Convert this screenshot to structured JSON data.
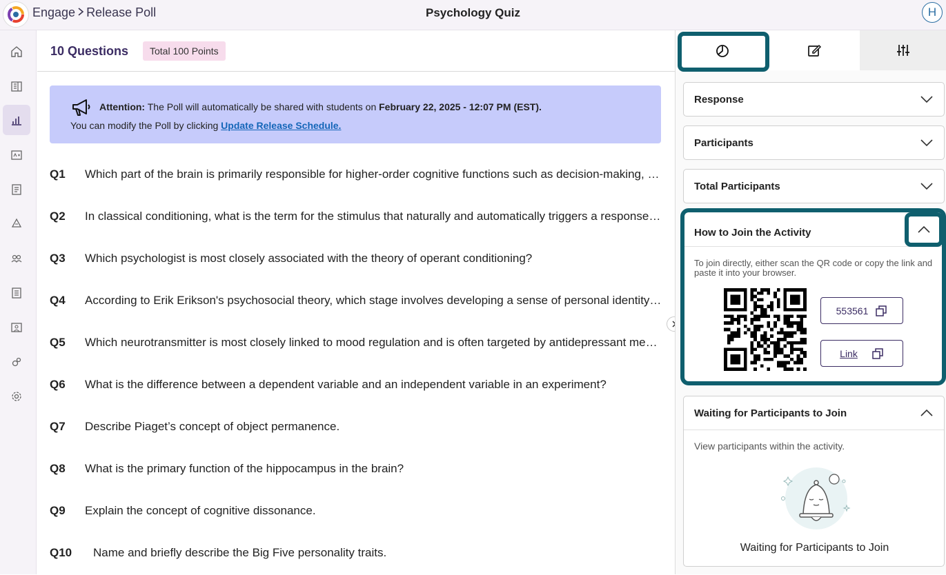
{
  "header": {
    "breadcrumb": [
      "Engage",
      "Release Poll"
    ],
    "title": "Psychology Quiz",
    "avatar_initial": "H"
  },
  "sidebar": {
    "items": [
      {
        "icon": "home-icon",
        "active": false
      },
      {
        "icon": "library-icon",
        "active": false
      },
      {
        "icon": "bar-chart-icon",
        "active": true
      },
      {
        "icon": "grades-icon",
        "active": false
      },
      {
        "icon": "document-icon",
        "active": false
      },
      {
        "icon": "recycle-icon",
        "active": false
      },
      {
        "icon": "users-icon",
        "active": false
      },
      {
        "icon": "list-icon",
        "active": false
      },
      {
        "icon": "gallery-icon",
        "active": false
      },
      {
        "icon": "puzzle-icon",
        "active": false
      },
      {
        "icon": "settings-icon",
        "active": false
      }
    ]
  },
  "main": {
    "question_count": "10 Questions",
    "total_points": "Total 100 Points",
    "attention": {
      "label": "Attention:",
      "message": " The Poll will automatically be shared with students on ",
      "datetime": "February 22, 2025 - 12:07 PM (EST).",
      "line2_prefix": "You can modify the Poll by clicking ",
      "link": "Update Release Schedule."
    },
    "questions": [
      {
        "num": "Q1",
        "text": "Which part of the brain is primarily responsible for higher-order cognitive functions such as decision-making, planning, and problem-solving?"
      },
      {
        "num": "Q2",
        "text": "In classical conditioning, what is the term for the stimulus that naturally and automatically triggers a response without prior learning?"
      },
      {
        "num": "Q3",
        "text": "Which psychologist is most closely associated with the theory of operant conditioning?"
      },
      {
        "num": "Q4",
        "text": "According to Erik Erikson's psychosocial theory, which stage involves developing a sense of personal identity during adolescence?"
      },
      {
        "num": "Q5",
        "text": "Which neurotransmitter is most closely linked to mood regulation and is often targeted by antidepressant medications?"
      },
      {
        "num": "Q6",
        "text": "What is the difference between a dependent variable and an independent variable in an experiment?"
      },
      {
        "num": "Q7",
        "text": "Describe Piaget’s concept of object permanence."
      },
      {
        "num": "Q8",
        "text": "What is the primary function of the hippocampus in the brain?"
      },
      {
        "num": "Q9",
        "text": "Explain the concept of cognitive dissonance."
      },
      {
        "num": "Q10",
        "text": "Name and briefly describe the Big Five personality traits."
      }
    ]
  },
  "panel": {
    "tabs": [
      {
        "icon": "pie-chart-icon",
        "active": true
      },
      {
        "icon": "edit-icon",
        "active": false
      },
      {
        "icon": "sliders-icon",
        "active": false
      }
    ],
    "sections": [
      {
        "title": "Response"
      },
      {
        "title": "Participants"
      },
      {
        "title": "Total Participants"
      }
    ],
    "join": {
      "title": "How to Join the Activity",
      "description": "To join directly, either scan the QR code or copy the link and paste it into your browser.",
      "code": "553561",
      "link_label": "Link"
    },
    "waiting": {
      "title": "Waiting for Participants to Join",
      "description": "View participants within the activity.",
      "caption": "Waiting for Participants to Join"
    }
  },
  "colors": {
    "accent": "#3b2c63",
    "highlight_border": "#0f5f6e",
    "attention_bg": "#c6cbfb",
    "badge_bg": "#f7dcec",
    "link": "#1466b8"
  }
}
